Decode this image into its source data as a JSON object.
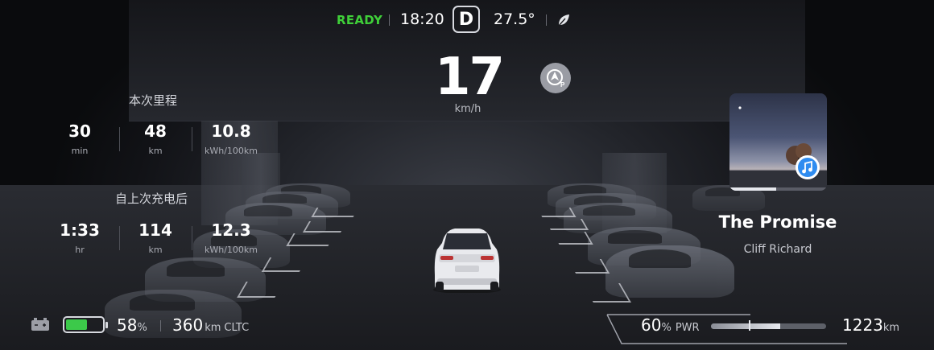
{
  "status": {
    "ready_label": "READY",
    "time": "18:20",
    "gear": "D",
    "temperature": "27.5°",
    "mode_icon": "leaf-icon"
  },
  "speed": {
    "value": "17",
    "unit": "km/h",
    "assist_icon": "autopilot-p-icon"
  },
  "trip_current": {
    "title": "本次里程",
    "stats": [
      {
        "value": "30",
        "unit": "min"
      },
      {
        "value": "48",
        "unit": "km"
      },
      {
        "value": "10.8",
        "unit": "kWh/100km"
      }
    ]
  },
  "trip_since_charge": {
    "title": "自上次充电后",
    "stats": [
      {
        "value": "1:33",
        "unit": "hr"
      },
      {
        "value": "114",
        "unit": "km"
      },
      {
        "value": "12.3",
        "unit": "kWh/100km"
      }
    ]
  },
  "media": {
    "song": "The Promise",
    "artist": "Cliff Richard",
    "progress": 0.48,
    "source_icon": "music-app-icon"
  },
  "bottom": {
    "battery_icon": "car-battery-icon",
    "battery_percent": "58",
    "battery_percent_unit": "%",
    "battery_level": 0.58,
    "range_value": "360",
    "range_unit": "km",
    "range_standard": "CLTC",
    "power_percent": "60",
    "power_percent_unit": "%",
    "power_label": "PWR",
    "power_level": 0.6,
    "odometer_value": "1223",
    "odometer_unit": "km"
  },
  "colors": {
    "ready_green": "#3fcf39",
    "battery_green": "#3cc94a",
    "background": "#0c0d10"
  }
}
